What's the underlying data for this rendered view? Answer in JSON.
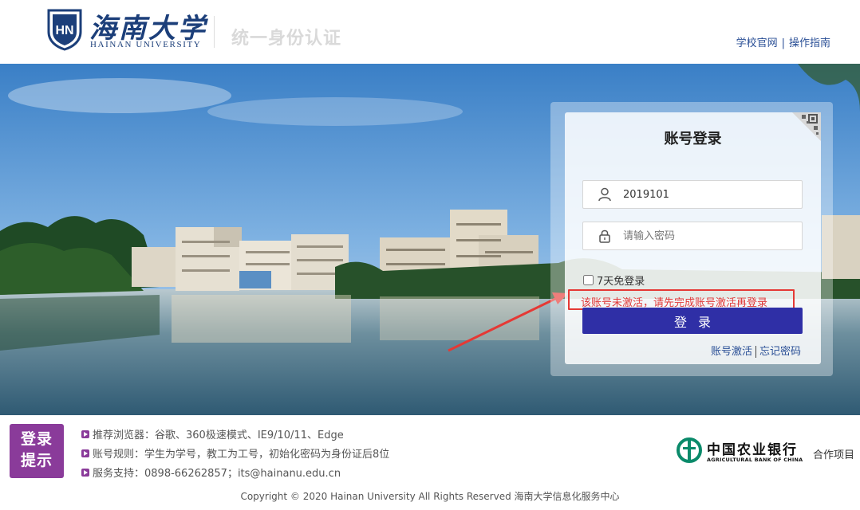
{
  "header": {
    "logo_cn": "海南大学",
    "logo_en": "HAINAN UNIVERSITY",
    "system_title": "统一身份认证",
    "links": [
      "学校官网",
      "操作指南"
    ],
    "link_divider": "|"
  },
  "login": {
    "title": "账号登录",
    "username_value": "2019101",
    "password_placeholder": "请输入密码",
    "remember_label": "7天免登录",
    "remember_checked": false,
    "error_message": "该账号未激活，请先完成账号激活再登录",
    "submit_label": "登录",
    "links": [
      "账号激活",
      "忘记密码"
    ]
  },
  "footer": {
    "badge_lines": [
      "登录",
      "提示"
    ],
    "tips": [
      "推荐浏览器：谷歌、360极速模式、IE9/10/11、Edge",
      "账号规则：学生为学号，教工为工号，初始化密码为身份证后8位",
      "服务支持：0898-66262857；its@hainanu.edu.cn"
    ],
    "bank_name_cn": "中国农业银行",
    "bank_name_en": "AGRICULTURAL BANK OF CHINA",
    "partner_label": "合作项目",
    "copyright": "Copyright © 2020 Hainan University All Rights Reserved 海南大学信息化服务中心"
  },
  "colors": {
    "brand_blue": "#1c3f7a",
    "link_blue": "#2a4f96",
    "button_purple": "#2f2fa6",
    "error_red": "#e53935",
    "badge_purple": "#8a3b9a",
    "bank_green": "#0a8a6a"
  },
  "icons": [
    "university-emblem-icon",
    "user-icon",
    "lock-icon",
    "qr-code-icon",
    "bank-logo-icon"
  ]
}
